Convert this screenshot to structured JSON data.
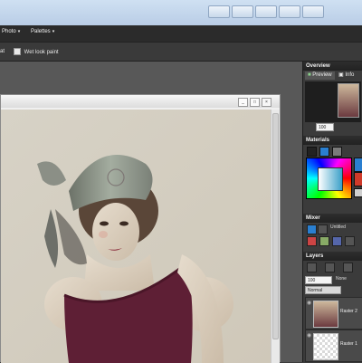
{
  "menu": {
    "items": [
      {
        "label": "Photo"
      },
      {
        "label": "Palettes"
      }
    ]
  },
  "tool_options": {
    "checkbox1_label": "at",
    "checkbox2_label": "Wet look paint"
  },
  "document": {
    "close_glyph": "×",
    "min_glyph": "_",
    "max_glyph": "□"
  },
  "palettes": {
    "overview": {
      "title": "Overview",
      "tabs": [
        "Preview",
        "Info"
      ],
      "zoom": "100"
    },
    "materials": {
      "title": "Materials"
    },
    "mixer": {
      "title": "Mixer",
      "preset": "Untitled"
    },
    "layers": {
      "title": "Layers",
      "opacity": "100",
      "blend_mode": "Normal",
      "lock_label": "None",
      "rows": [
        {
          "name": "Raster 2"
        },
        {
          "name": "Raster 1"
        }
      ]
    }
  },
  "colors": {
    "menubar": "#2b2b2b",
    "workspace": "#585858",
    "palette_bg": "#3b3b3b",
    "accent": "#2f7fd6"
  }
}
